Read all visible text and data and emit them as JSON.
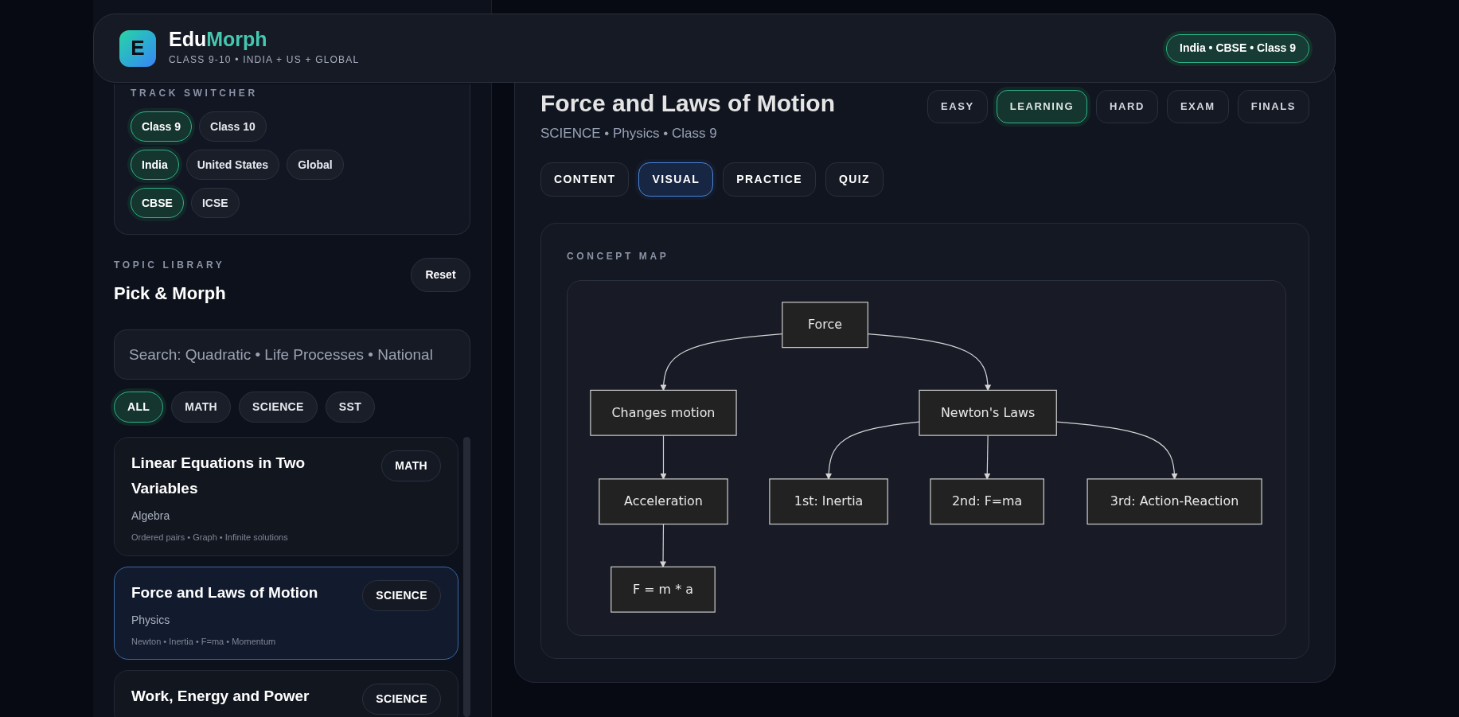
{
  "header": {
    "logo_letter": "E",
    "brand_parts": [
      {
        "text": "Edu",
        "accent": false
      },
      {
        "text": "Morph",
        "accent": true
      }
    ],
    "tagline": "CLASS 9-10 • INDIA + US + GLOBAL",
    "track_badge": "India • CBSE • Class 9"
  },
  "track_switcher": {
    "label": "TRACK SWITCHER",
    "groups": [
      [
        {
          "label": "Class 9",
          "selected": true
        },
        {
          "label": "Class 10",
          "selected": false
        }
      ],
      [
        {
          "label": "India",
          "selected": true
        },
        {
          "label": "United States",
          "selected": false
        },
        {
          "label": "Global",
          "selected": false
        }
      ],
      [
        {
          "label": "CBSE",
          "selected": true
        },
        {
          "label": "ICSE",
          "selected": false
        }
      ]
    ]
  },
  "topic_library": {
    "label": "TOPIC LIBRARY",
    "title": "Pick & Morph",
    "reset": "Reset",
    "search_placeholder": "Search: Quadratic • Life Processes • National",
    "filters": [
      {
        "label": "ALL",
        "selected": true
      },
      {
        "label": "MATH",
        "selected": false
      },
      {
        "label": "SCIENCE",
        "selected": false
      },
      {
        "label": "SST",
        "selected": false
      }
    ],
    "topics": [
      {
        "title": "Linear Equations in Two Variables",
        "subject": "MATH",
        "area": "Algebra",
        "keywords": "Ordered pairs • Graph • Infinite solutions",
        "selected": false
      },
      {
        "title": "Force and Laws of Motion",
        "subject": "SCIENCE",
        "area": "Physics",
        "keywords": "Newton • Inertia • F=ma • Momentum",
        "selected": true
      },
      {
        "title": "Work, Energy and Power",
        "subject": "SCIENCE",
        "selected": false
      }
    ]
  },
  "main": {
    "title": "Force and Laws of Motion",
    "subtitle": "SCIENCE • Physics • Class 9",
    "levels": [
      {
        "label": "EASY",
        "selected": false
      },
      {
        "label": "LEARNING",
        "selected": true
      },
      {
        "label": "HARD",
        "selected": false
      },
      {
        "label": "EXAM",
        "selected": false
      },
      {
        "label": "FINALS",
        "selected": false
      }
    ],
    "tabs": [
      {
        "label": "CONTENT",
        "selected": false
      },
      {
        "label": "VISUAL",
        "selected": true
      },
      {
        "label": "PRACTICE",
        "selected": false
      },
      {
        "label": "QUIZ",
        "selected": false
      }
    ],
    "concept_map": {
      "label": "CONCEPT MAP",
      "root": {
        "label": "Force",
        "children": [
          {
            "label": "Changes motion",
            "children": [
              {
                "label": "Acceleration",
                "children": [
                  {
                    "label": "F = m * a"
                  }
                ]
              }
            ]
          },
          {
            "label": "Newton's Laws",
            "children": [
              {
                "label": "1st: Inertia"
              },
              {
                "label": "2nd: F=ma"
              },
              {
                "label": "3rd: Action-Reaction"
              }
            ]
          }
        ]
      }
    }
  }
}
